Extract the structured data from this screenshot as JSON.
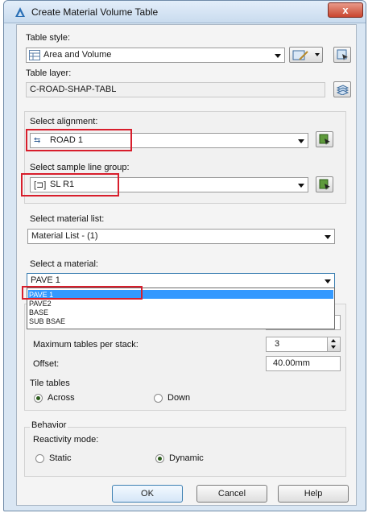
{
  "window": {
    "title": "Create Material Volume Table",
    "close_glyph": "x"
  },
  "table_style": {
    "label": "Table style:",
    "value": "Area and Volume"
  },
  "table_layer": {
    "label": "Table layer:",
    "value": "C-ROAD-SHAP-TABL"
  },
  "alignment": {
    "label": "Select alignment:",
    "value": "ROAD 1"
  },
  "sample_line_group": {
    "label": "Select sample line group:",
    "value": "SL R1"
  },
  "material_list": {
    "label": "Select material list:",
    "value": "Material List - (1)"
  },
  "material": {
    "label": "Select a material:",
    "value": "PAVE 1",
    "options": [
      "PAVE 1",
      "PAVE2",
      "BASE",
      "SUB BSAE"
    ]
  },
  "max_tables": {
    "label": "Maximum tables per stack:",
    "value": "3"
  },
  "offset": {
    "label": "Offset:",
    "value": "40.00mm"
  },
  "tile_tables": {
    "label": "Tile tables",
    "across": "Across",
    "down": "Down",
    "selected": "Across"
  },
  "behavior": {
    "header": "Behavior",
    "mode_label": "Reactivity mode:",
    "static": "Static",
    "dynamic": "Dynamic",
    "selected": "Dynamic"
  },
  "buttons": {
    "ok": "OK",
    "cancel": "Cancel",
    "help": "Help"
  },
  "colors": {
    "highlight_red": "#d81e2c",
    "selection_blue": "#3399ff",
    "title_gradient": "#c9dbee"
  }
}
